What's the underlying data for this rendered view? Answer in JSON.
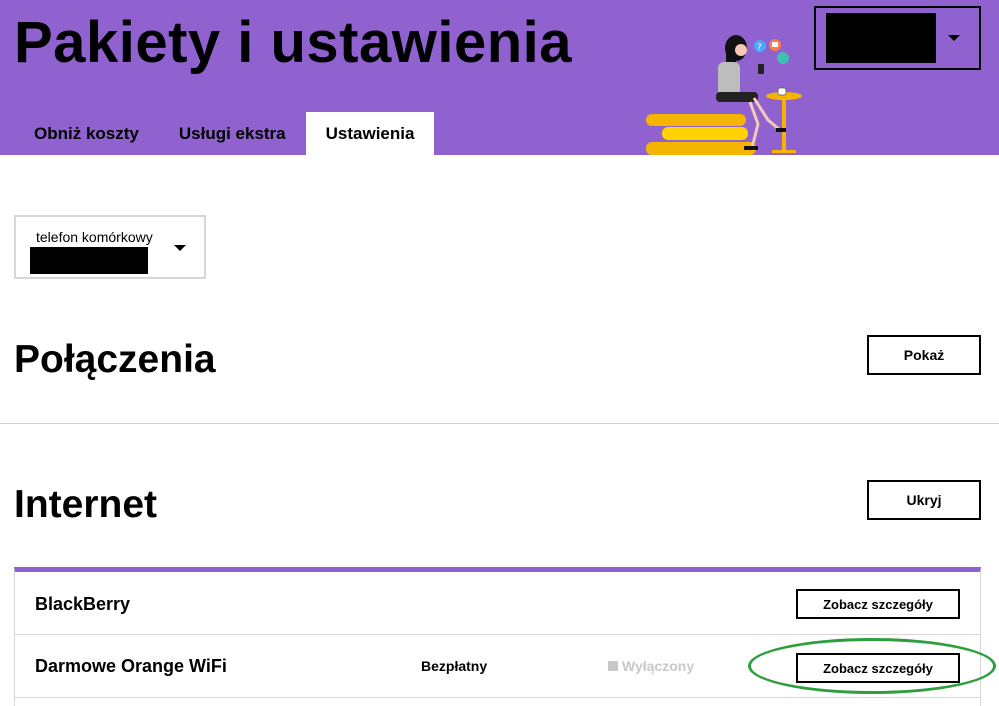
{
  "header": {
    "title": "Pakiety i ustawienia",
    "background_color": "#9062cf",
    "tabs": [
      {
        "label": "Obniż koszty",
        "active": false
      },
      {
        "label": "Usługi ekstra",
        "active": false
      },
      {
        "label": "Ustawienia",
        "active": true
      }
    ],
    "account_menu_icon": "chevron-down-icon"
  },
  "phone_selector": {
    "label": "telefon komórkowy",
    "icon": "chevron-down-icon"
  },
  "sections": {
    "connections": {
      "title": "Połączenia",
      "button_label": "Pokaż"
    },
    "internet": {
      "title": "Internet",
      "button_label": "Ukryj"
    }
  },
  "internet_services": [
    {
      "name": "BlackBerry",
      "price": "",
      "status": "",
      "details_label": "Zobacz szczegóły"
    },
    {
      "name": "Darmowe Orange WiFi",
      "price": "Bezpłatny",
      "status": "Wyłączony",
      "details_label": "Zobacz szczegóły"
    }
  ],
  "colors": {
    "accent": "#9062cf",
    "highlight": "#2e9e3f",
    "disabled_text": "#c8c8c8"
  }
}
